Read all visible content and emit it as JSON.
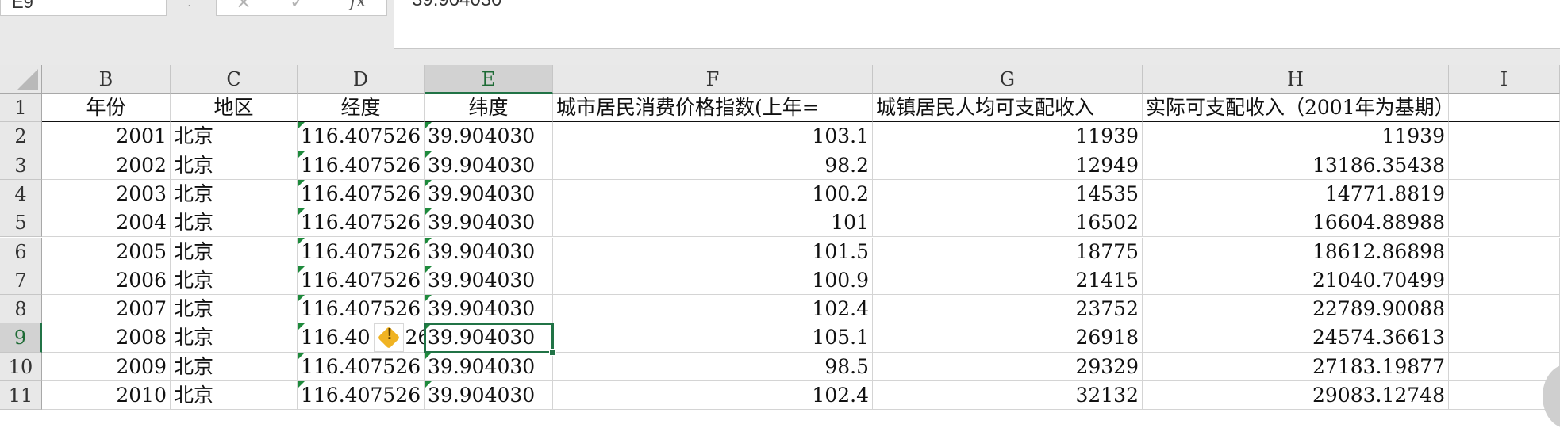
{
  "namebox": {
    "value": "E9"
  },
  "formula_bar": {
    "dots": ":",
    "cancel_icon": "×",
    "confirm_icon": "✓",
    "fx_label": "fx",
    "value": "39.904030"
  },
  "columns": [
    "B",
    "C",
    "D",
    "E",
    "F",
    "G",
    "H",
    "I"
  ],
  "row_numbers": [
    "1",
    "2",
    "3",
    "4",
    "5",
    "6",
    "7",
    "8",
    "9",
    "10",
    "11"
  ],
  "headers": [
    "年份",
    "地区",
    "经度",
    "纬度",
    "城市居民消费价格指数(上年=",
    "城镇居民人均可支配收入",
    "实际可支配收入（2001年为基期）"
  ],
  "rows": [
    [
      "2001",
      "北京",
      "116.407526",
      "39.904030",
      "103.1",
      "11939",
      "11939"
    ],
    [
      "2002",
      "北京",
      "116.407526",
      "39.904030",
      "98.2",
      "12949",
      "13186.35438"
    ],
    [
      "2003",
      "北京",
      "116.407526",
      "39.904030",
      "100.2",
      "14535",
      "14771.8819"
    ],
    [
      "2004",
      "北京",
      "116.407526",
      "39.904030",
      "101",
      "16502",
      "16604.88988"
    ],
    [
      "2005",
      "北京",
      "116.407526",
      "39.904030",
      "101.5",
      "18775",
      "18612.86898"
    ],
    [
      "2006",
      "北京",
      "116.407526",
      "39.904030",
      "100.9",
      "21415",
      "21040.70499"
    ],
    [
      "2007",
      "北京",
      "116.407526",
      "39.904030",
      "102.4",
      "23752",
      "22789.90088"
    ],
    [
      "2008",
      "北京",
      "116.40",
      "39.904030",
      "105.1",
      "26918",
      "24574.36613"
    ],
    [
      "2009",
      "北京",
      "116.407526",
      "39.904030",
      "98.5",
      "29329",
      "27183.19877"
    ],
    [
      "2010",
      "北京",
      "116.407526",
      "39.904030",
      "102.4",
      "32132",
      "29083.12748"
    ]
  ],
  "row8_d_tail": "26",
  "warning_icon": "!",
  "colors": {
    "accent": "#217346",
    "header_bg": "#e8e8e8",
    "warning": "#f0b323"
  }
}
